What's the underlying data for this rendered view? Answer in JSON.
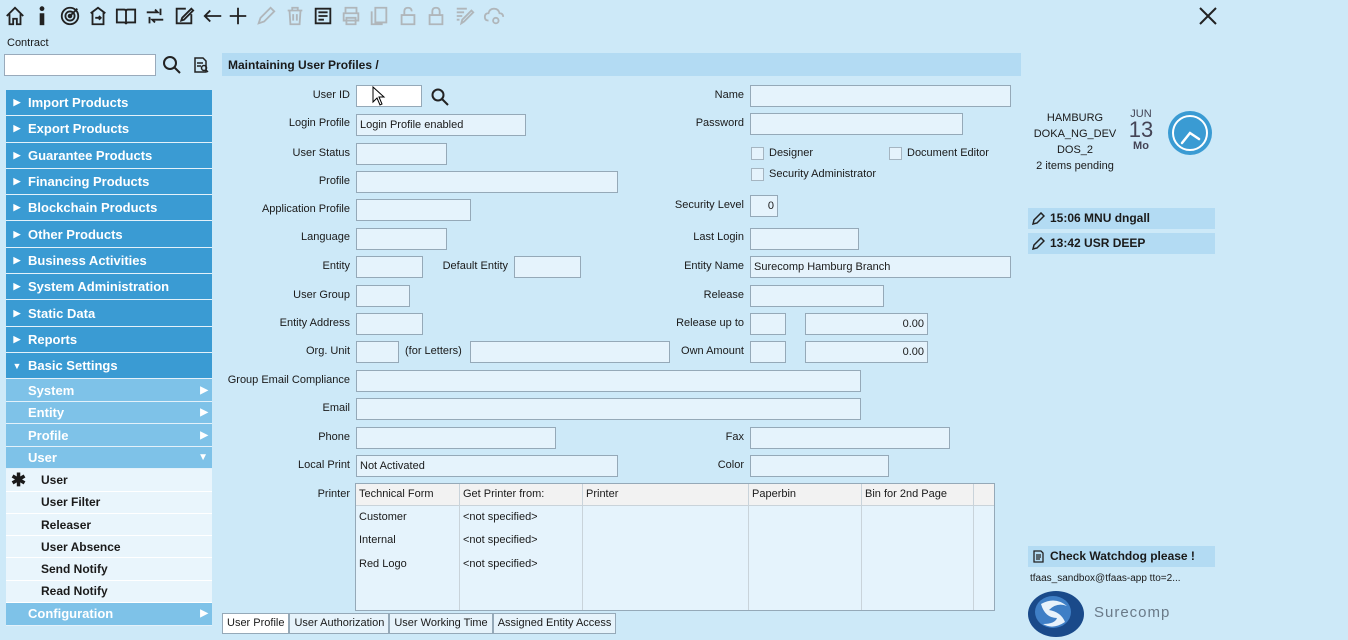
{
  "toolbar": {
    "icons": [
      "home-icon",
      "info-icon",
      "target-icon",
      "export-icon",
      "book-icon",
      "exchange-icon",
      "edit-icon",
      "back-arrow-icon",
      "plus-icon",
      "pencil-icon",
      "trash-icon",
      "report-icon",
      "print-icon",
      "copy-icon",
      "unlock-icon",
      "lock-icon",
      "edit-list-icon",
      "cloud-icon"
    ]
  },
  "contract": {
    "label": "Contract",
    "value": ""
  },
  "nav": {
    "top": [
      "Import Products",
      "Export Products",
      "Guarantee Products",
      "Financing Products",
      "Blockchain Products",
      "Other Products",
      "Business Activities",
      "System Administration",
      "Static Data",
      "Reports"
    ],
    "basic": "Basic Settings",
    "basic_sub": [
      "System",
      "Entity",
      "Profile",
      "User"
    ],
    "user_leaves": [
      "User",
      "User Filter",
      "Releaser",
      "User Absence",
      "Send Notify",
      "Read Notify"
    ],
    "configuration": "Configuration"
  },
  "header": {
    "title": "Maintaining User Profiles /"
  },
  "form": {
    "user_id": {
      "label": "User ID",
      "value": ""
    },
    "login_profile": {
      "label": "Login Profile",
      "value": "Login Profile enabled"
    },
    "user_status": {
      "label": "User Status",
      "value": ""
    },
    "profile": {
      "label": "Profile",
      "value": ""
    },
    "application_profile": {
      "label": "Application Profile",
      "value": ""
    },
    "language": {
      "label": "Language",
      "value": ""
    },
    "entity": {
      "label": "Entity",
      "value": ""
    },
    "default_entity": {
      "label": "Default Entity",
      "value": ""
    },
    "user_group": {
      "label": "User Group",
      "value": ""
    },
    "entity_address": {
      "label": "Entity Address",
      "value": ""
    },
    "org_unit": {
      "label": "Org. Unit",
      "value": "",
      "for_letters": "(for Letters)",
      "letters_value": ""
    },
    "group_email": {
      "label": "Group Email Compliance",
      "value": ""
    },
    "email": {
      "label": "Email",
      "value": ""
    },
    "phone": {
      "label": "Phone",
      "value": ""
    },
    "local_print": {
      "label": "Local Print",
      "value": "Not Activated"
    },
    "name": {
      "label": "Name",
      "value": ""
    },
    "password": {
      "label": "Password",
      "value": ""
    },
    "designer": "Designer",
    "document_editor": "Document Editor",
    "security_admin": "Security Administrator",
    "security_level": {
      "label": "Security Level",
      "value": "0"
    },
    "last_login": {
      "label": "Last Login",
      "value": ""
    },
    "entity_name": {
      "label": "Entity Name",
      "value": "Surecomp Hamburg Branch"
    },
    "release": {
      "label": "Release",
      "value": ""
    },
    "release_up_to": {
      "label": "Release up to",
      "value": "",
      "amount": "0.00"
    },
    "own_amount": {
      "label": "Own Amount",
      "value": "",
      "amount": "0.00"
    },
    "fax": {
      "label": "Fax",
      "value": ""
    },
    "color": {
      "label": "Color",
      "value": ""
    },
    "printer": {
      "label": "Printer"
    }
  },
  "printer_table": {
    "headers": [
      "Technical Form",
      "Get Printer from:",
      "Printer",
      "Paperbin",
      "Bin for 2nd Page"
    ],
    "rows": [
      [
        "Customer",
        "<not specified>",
        "",
        "",
        ""
      ],
      [
        "Internal",
        "<not specified>",
        "",
        "",
        ""
      ],
      [
        "Red Logo",
        "<not specified>",
        "",
        "",
        ""
      ]
    ]
  },
  "tabs": [
    "User Profile",
    "User Authorization",
    "User Working Time",
    "Assigned Entity Access"
  ],
  "info": {
    "city": "HAMBURG",
    "system": "DOKA_NG_DEV",
    "server": "DOS_2",
    "pending": "2 items pending"
  },
  "date": {
    "month": "JUN",
    "day": "13",
    "weekday": "Mo"
  },
  "recent": [
    {
      "time": "15:06 MNU dngall"
    },
    {
      "time": "13:42 USR DEEP"
    }
  ],
  "watchdog": "Check Watchdog please !",
  "user_line": "tfaas_sandbox@tfaas-app tto=2...",
  "logo_text": "Surecomp"
}
